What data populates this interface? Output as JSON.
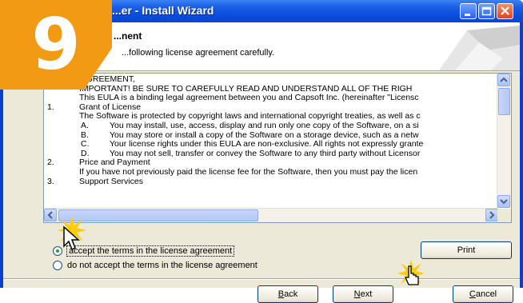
{
  "window": {
    "title": "...er - Install Wizard"
  },
  "header": {
    "title": "...nent",
    "subtitle": "...following license agreement carefully."
  },
  "license": {
    "lines": [
      {
        "num": "",
        "text": "...GREEMENT,",
        "indent": false
      },
      {
        "num": "",
        "text": "IMPORTANT! BE SURE TO CAREFULLY READ AND UNDERSTAND ALL OF THE RIGH",
        "indent": false
      },
      {
        "num": "",
        "text": "This EULA is a binding legal agreement between you and Capsoft Inc. (hereinafter \"Licensc",
        "indent": false
      },
      {
        "num": "1.",
        "text": "Grant of License",
        "indent": false
      },
      {
        "num": "",
        "text": "The Software is protected by copyright laws and international copyright treaties, as well as c",
        "indent": false
      },
      {
        "num": "A.",
        "text": "You may install, use, access, display and run only one copy of the Software, on a si",
        "indent": true
      },
      {
        "num": "B.",
        "text": "You may store or install a copy of the Software on a storage device, such as a netw",
        "indent": true
      },
      {
        "num": "C.",
        "text": "Your license rights under this EULA are non-exclusive. All rights not expressly grante",
        "indent": true
      },
      {
        "num": "D.",
        "text": "You may not sell, transfer or convey the Software to any third party without Licensor",
        "indent": true
      },
      {
        "num": "2.",
        "text": "Price and Payment",
        "indent": false
      },
      {
        "num": "",
        "text": "If you have not previously paid the license fee for the Software, then you must pay the licen",
        "indent": false
      },
      {
        "num": "3.",
        "text": "Support Services",
        "indent": false
      }
    ]
  },
  "options": {
    "accept_label": "accept the terms in the license agreement",
    "decline_label": "do not accept the terms in the license agreement",
    "selected": "accept"
  },
  "buttons": {
    "print": "Print",
    "back_ul": "B",
    "back_rest": "ack",
    "next_ul": "N",
    "next_rest": "ext",
    "cancel_ul": "C",
    "cancel_rest": "ancel"
  },
  "badge": {
    "number": "9"
  },
  "icons": {
    "minimize": "minimize-icon",
    "maximize": "maximize-icon",
    "close": "close-icon",
    "scroll_up": "arrow-up-icon",
    "scroll_down": "arrow-down-icon",
    "scroll_left": "arrow-left-icon",
    "scroll_right": "arrow-right-icon",
    "cursor": "mouse-cursor-icon",
    "burst": "click-burst-icon"
  },
  "colors": {
    "titlebar": "#0a4cdb",
    "badge": "#f39a14",
    "burst": "#ffcc00"
  }
}
